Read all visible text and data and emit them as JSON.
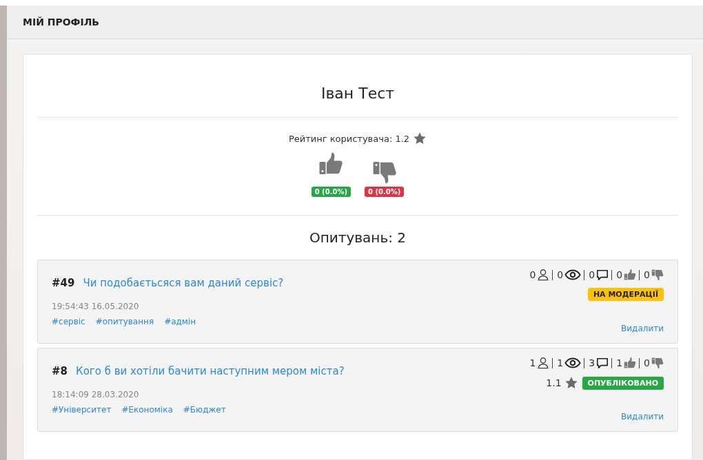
{
  "header": {
    "title": "МІЙ ПРОФІЛЬ"
  },
  "profile": {
    "name": "Іван Тест",
    "rating_label": "Рейтинг користувача: 1.2",
    "likes": "0 (0.0%)",
    "dislikes": "0 (0.0%)"
  },
  "polls_heading": "Опитувань: 2",
  "polls": [
    {
      "number": "#49",
      "title": "Чи подобаєтьсяся вам даний сервіс?",
      "date": "19:54:43 16.05.2020",
      "tags": [
        "#сервіс",
        "#опитування",
        "#адмін"
      ],
      "participants": "0",
      "views": "0",
      "comments": "0",
      "likes": "0",
      "dislikes": "0",
      "status": {
        "kind": "moderation",
        "label": "НА МОДЕРАЦІЇ"
      },
      "delete": "Видалити"
    },
    {
      "number": "#8",
      "title": "Кого б ви хотіли бачити наступним мером міста?",
      "date": "18:14:09 28.03.2020",
      "tags": [
        "#Університет",
        "#Економіка",
        "#Бюджет"
      ],
      "participants": "1",
      "views": "1",
      "comments": "3",
      "likes": "1",
      "dislikes": "0",
      "rating": "1.1",
      "status": {
        "kind": "published",
        "label": "ОПУБЛІКОВАНО"
      },
      "delete": "Видалити"
    }
  ]
}
